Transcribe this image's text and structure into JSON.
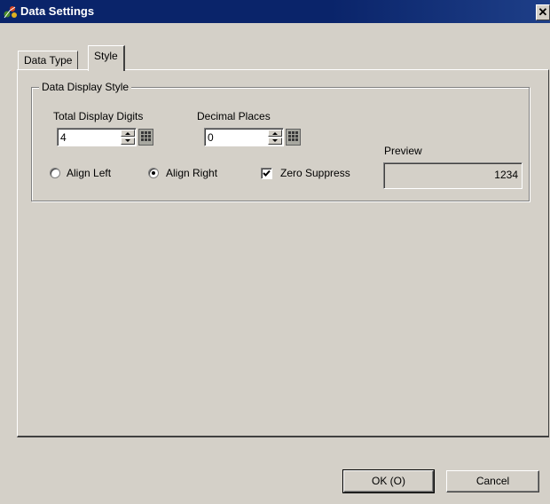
{
  "window": {
    "title": "Data Settings",
    "icon": "app-icon",
    "close_label": "✕"
  },
  "tabs": [
    {
      "label": "Data Type",
      "active": false
    },
    {
      "label": "Style",
      "active": true
    }
  ],
  "group": {
    "label": "Data Display Style",
    "total_digits": {
      "label": "Total Display Digits",
      "value": "4"
    },
    "decimal_places": {
      "label": "Decimal Places",
      "value": "0"
    },
    "align_left": {
      "label": "Align Left",
      "checked": false
    },
    "align_right": {
      "label": "Align Right",
      "checked": true
    },
    "zero_suppress": {
      "label": "Zero Suppress",
      "checked": true
    },
    "preview": {
      "label": "Preview",
      "value": "1234"
    }
  },
  "buttons": {
    "ok": "OK (O)",
    "cancel": "Cancel"
  }
}
